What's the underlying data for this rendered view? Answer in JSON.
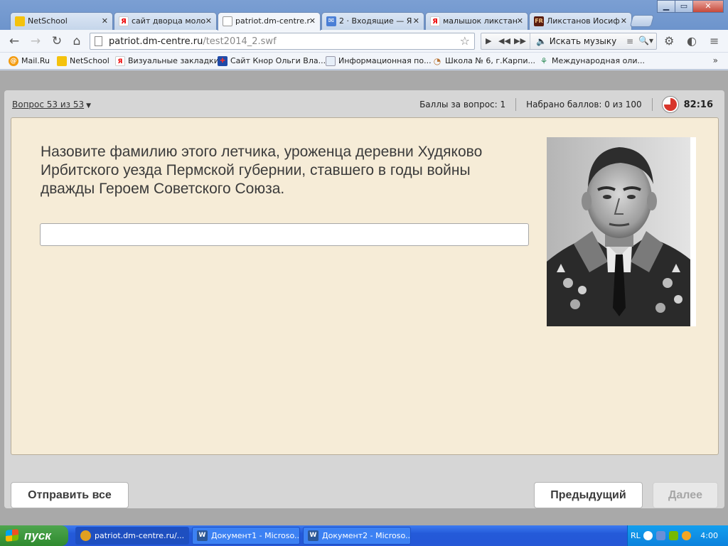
{
  "browser": {
    "tabs": [
      {
        "title": "NetSchool",
        "fav": "",
        "favColor": "#f4c20d"
      },
      {
        "title": "сайт дворца моло",
        "fav": "Я",
        "favColor": "#ffffff"
      },
      {
        "title": "patriot.dm-centre.r",
        "fav": "",
        "favColor": "#ffffff"
      },
      {
        "title": "2 · Входящие — Я",
        "fav": "✉",
        "favColor": "#4a7fd6"
      },
      {
        "title": "малышок ликстан",
        "fav": "Я",
        "favColor": "#ffffff"
      },
      {
        "title": "Ликстанов Иосиф",
        "fav": "FR",
        "favColor": "#5a1d10"
      }
    ],
    "url_host": "patriot.dm-centre.ru",
    "url_path": "/test2014_2.swf",
    "music_search": "Искать музыку",
    "bookmarks": [
      {
        "label": "Mail.Ru",
        "fav": "@",
        "color": "#f39c12"
      },
      {
        "label": "NetSchool",
        "fav": "",
        "color": "#f4c20d"
      },
      {
        "label": "Визуальные закладки",
        "fav": "Я",
        "color": "#ffffff"
      },
      {
        "label": "Сайт Кнор Ольги Вла...",
        "fav": "✚",
        "color": "#1f4aa8"
      },
      {
        "label": "Информационная по...",
        "fav": "",
        "color": "#e6eef8"
      },
      {
        "label": "Школа № 6, г.Карпи...",
        "fav": "◔",
        "color": "#b87333"
      },
      {
        "label": "Международная оли...",
        "fav": "⚘",
        "color": "#ffffff"
      }
    ],
    "bookmarks_more": "»"
  },
  "quiz": {
    "question_counter": "Вопрос 53 из 53",
    "points_per_question": "Баллы за вопрос: 1",
    "points_total": "Набрано баллов: 0 из 100",
    "timer": "82:16",
    "question": "Назовите фамилию этого летчика, уроженца  деревни Худяково Ирбитского уезда Пермской губернии, ставшего в годы войны дважды Героем Советского Союза.",
    "answer_value": "",
    "submit_all": "Отправить все",
    "previous": "Предыдущий",
    "next": "Далее"
  },
  "taskbar": {
    "start": "пуск",
    "tasks": [
      {
        "label": "patriot.dm-centre.ru/...",
        "color": "#e0a020"
      },
      {
        "label": "Документ1 - Microso...",
        "color": "#2b5797"
      },
      {
        "label": "Документ2 - Microso...",
        "color": "#2b5797"
      }
    ],
    "lang": "RL",
    "clock": "4:00"
  }
}
